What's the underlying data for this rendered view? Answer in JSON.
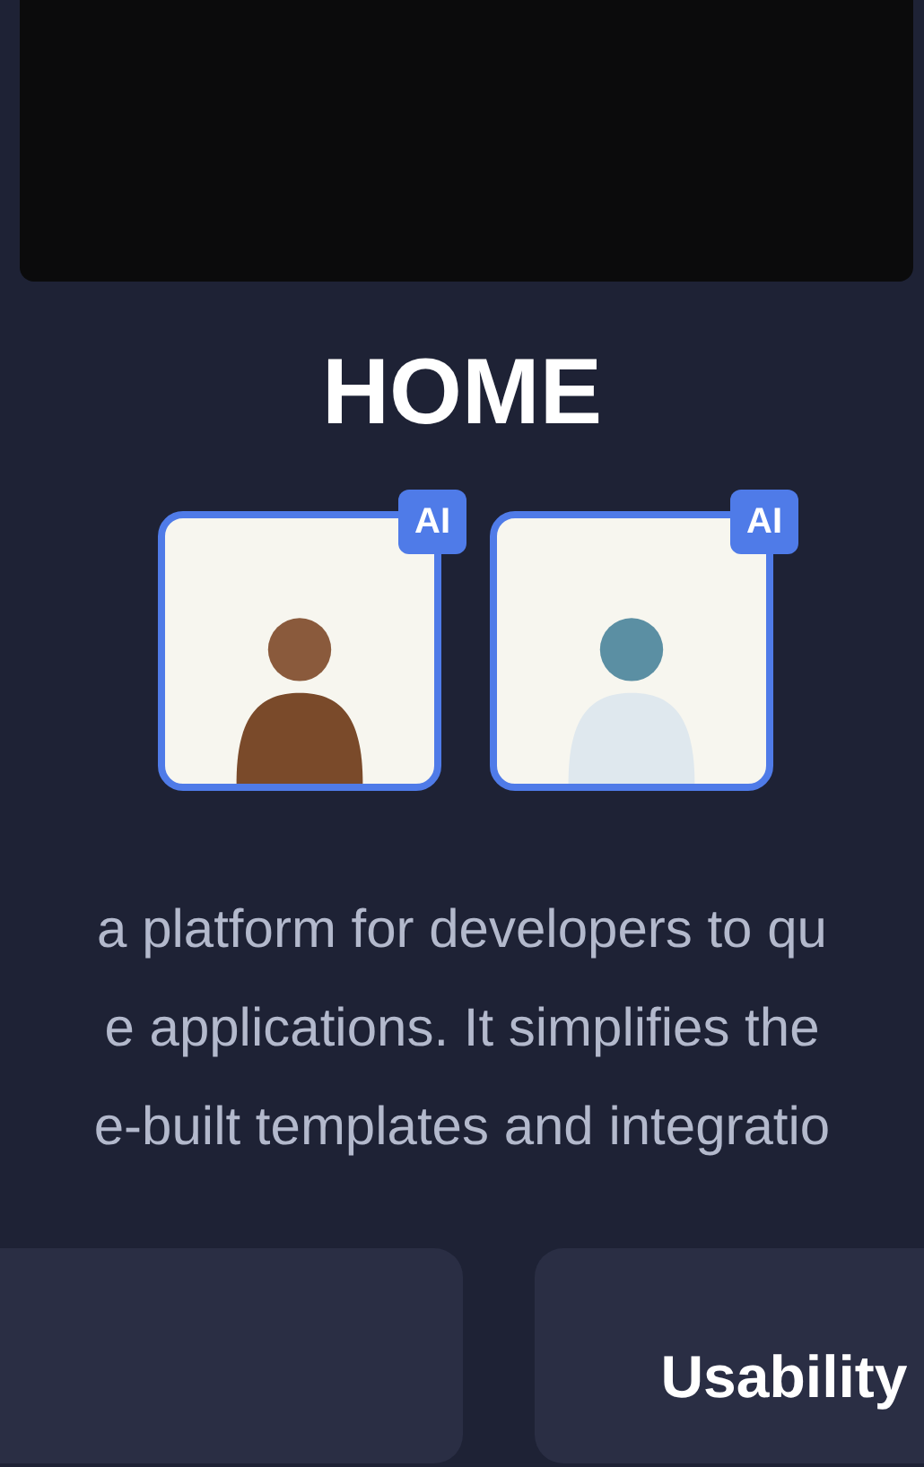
{
  "title": "HOME",
  "avatars": [
    {
      "badge": "AI"
    },
    {
      "badge": "AI"
    }
  ],
  "description": {
    "lines": [
      "a platform for developers to qu",
      "e applications. It simplifies the",
      "e-built templates and integratio"
    ]
  },
  "cards": [
    {
      "title": "Usability"
    }
  ]
}
